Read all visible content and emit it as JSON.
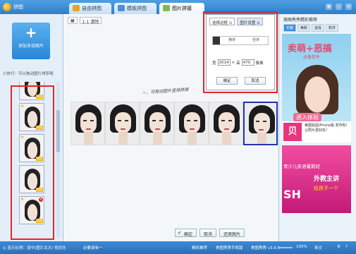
{
  "titlebar": {
    "app_title": "拼图",
    "tabs": [
      "自由拼图",
      "模板拼图",
      "图片拼接"
    ],
    "tab_icon_colors": [
      "#e7a22a",
      "#4e8fd8",
      "#7bbd4a"
    ]
  },
  "left": {
    "add_button_label": "添加多张图片",
    "hint": "小技巧：可以拖动图片排序哦",
    "thumb_tag": "替换"
  },
  "main": {
    "mode_buttons": [
      "▦",
      "1:1 清除"
    ],
    "handwritten": "☆、可拖动图片竖排拼接",
    "buttons": {
      "ok": "确定",
      "cancel": "取消",
      "undo": "还原图片"
    }
  },
  "popup": {
    "tabs": [
      "选择边框 ⊙",
      "图片设置 ⊙"
    ],
    "segments": [
      "横排",
      "竖排"
    ],
    "width_label": "宽",
    "width_value": "2014",
    "height_label": "高",
    "height_value": "470",
    "unit": "像素",
    "ok": "确定",
    "cancel": "取消"
  },
  "right": {
    "title": "美图秀秀精彩推荐",
    "tabs": [
      "花瓣",
      "美颜",
      "道具",
      "软件"
    ],
    "ad1": {
      "line1": "卖萌+恶搞",
      "line2": "必备软件",
      "line3": "进入体验"
    },
    "ad_row": {
      "icon": "贝",
      "text": "美图贴贴iPhone版 发布啦！让照片更好玩！"
    },
    "ad2": {
      "line1": "青少儿英语暑期班",
      "line2": "外教主讲",
      "line3": "给孩子一个",
      "brand": "SH"
    }
  },
  "status": {
    "left": "◎ 显示比例：适中(图片太大) 低优化",
    "mid": "必要请单一",
    "right1": "精彩推荐",
    "right2": "美图秀秀手机版",
    "right3": "美图秀秀 v3.9.5",
    "zoom": "100%",
    "language": "英文"
  }
}
